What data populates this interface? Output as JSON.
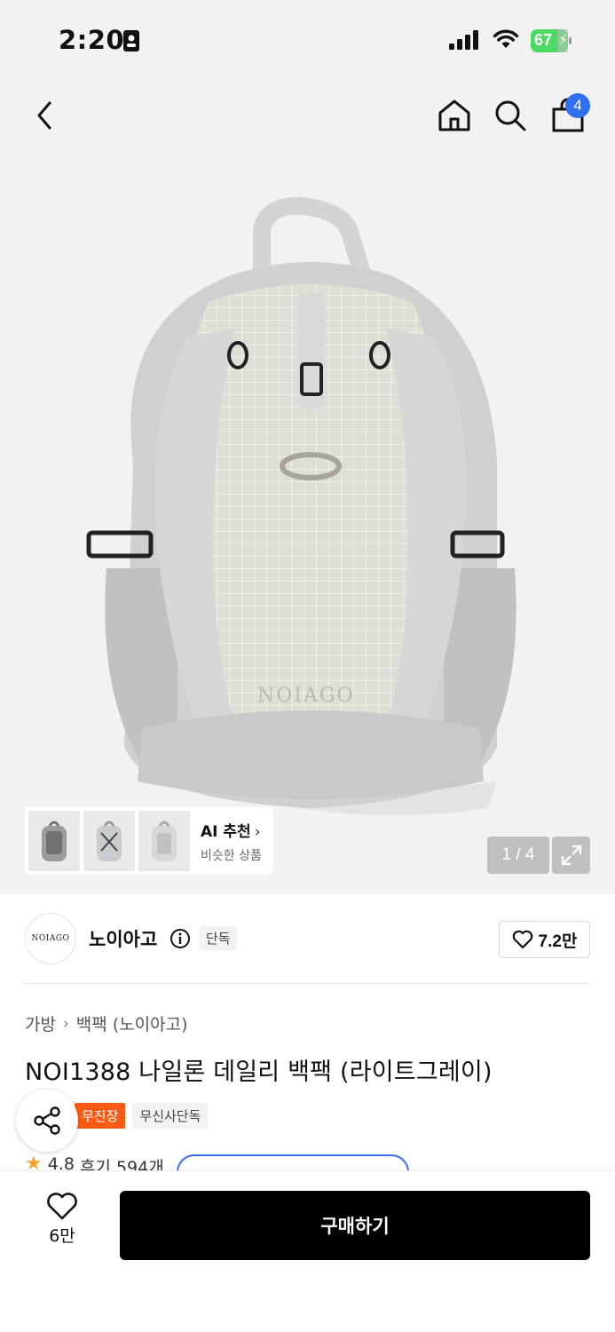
{
  "status_bar": {
    "time": "2:20",
    "battery": "67"
  },
  "header": {
    "cart_count": "4"
  },
  "gallery": {
    "watermark": "NOIAGO",
    "page_indicator": "1 / 4",
    "ai_recommend": {
      "title": "AI 추천",
      "subtitle": "비슷한 상품"
    }
  },
  "brand": {
    "logo_text": "NOIAGO",
    "name": "노이아고",
    "tag": "단독",
    "likes": "7.2만"
  },
  "breadcrumb": [
    "가방",
    "백팩 (노이아고)"
  ],
  "product": {
    "title": "NOI1388 나일론 데일리 백팩 (라이트그레이)",
    "tags": [
      "무진장",
      "무신사단독"
    ],
    "rating": "4.8",
    "reviews": "후기 594개"
  },
  "bottom": {
    "wish_count": "6만",
    "buy_label": "구매하기"
  },
  "colors": {
    "accent_blue": "#2f6ff0",
    "tag_orange": "#ff5a14",
    "star": "#f7a531",
    "buy_button": "#000000"
  }
}
